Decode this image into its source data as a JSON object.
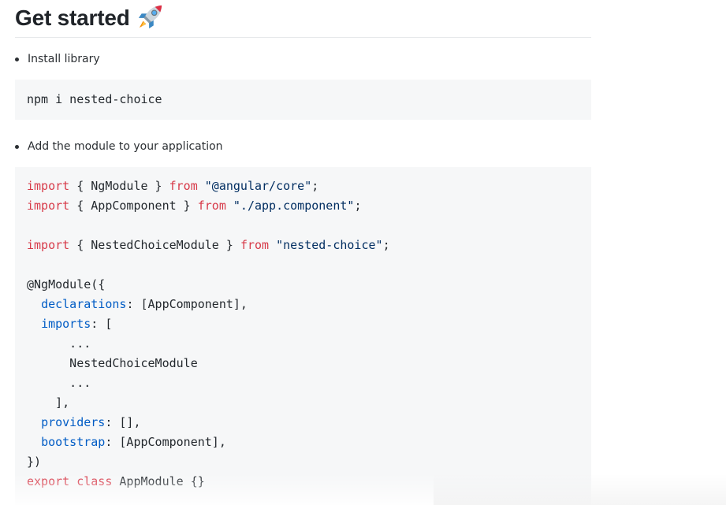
{
  "heading": {
    "title": "Get started",
    "emoji_icon": "rocket-icon"
  },
  "steps": [
    {
      "text": "Install library"
    },
    {
      "text": "Add the module to your application"
    }
  ],
  "code_blocks": [
    {
      "lines": [
        [
          {
            "t": "pl",
            "v": "npm i nested-choice"
          }
        ]
      ]
    },
    {
      "lines": [
        [
          {
            "t": "kw",
            "v": "import"
          },
          {
            "t": "pl",
            "v": " { NgModule } "
          },
          {
            "t": "kw",
            "v": "from"
          },
          {
            "t": "pl",
            "v": " "
          },
          {
            "t": "str",
            "v": "\"@angular/core\""
          },
          {
            "t": "pl",
            "v": ";"
          }
        ],
        [
          {
            "t": "kw",
            "v": "import"
          },
          {
            "t": "pl",
            "v": " { AppComponent } "
          },
          {
            "t": "kw",
            "v": "from"
          },
          {
            "t": "pl",
            "v": " "
          },
          {
            "t": "str",
            "v": "\"./app.component\""
          },
          {
            "t": "pl",
            "v": ";"
          }
        ],
        [],
        [
          {
            "t": "kw",
            "v": "import"
          },
          {
            "t": "pl",
            "v": " { NestedChoiceModule } "
          },
          {
            "t": "kw",
            "v": "from"
          },
          {
            "t": "pl",
            "v": " "
          },
          {
            "t": "str",
            "v": "\"nested-choice\""
          },
          {
            "t": "pl",
            "v": ";"
          }
        ],
        [],
        [
          {
            "t": "pl",
            "v": "@NgModule({"
          }
        ],
        [
          {
            "t": "pl",
            "v": "  "
          },
          {
            "t": "prop",
            "v": "declarations"
          },
          {
            "t": "pl",
            "v": ": [AppComponent],"
          }
        ],
        [
          {
            "t": "pl",
            "v": "  "
          },
          {
            "t": "prop",
            "v": "imports"
          },
          {
            "t": "pl",
            "v": ": ["
          }
        ],
        [
          {
            "t": "pl",
            "v": "      ..."
          }
        ],
        [
          {
            "t": "pl",
            "v": "      NestedChoiceModule"
          }
        ],
        [
          {
            "t": "pl",
            "v": "      ..."
          }
        ],
        [
          {
            "t": "pl",
            "v": "    ],"
          }
        ],
        [
          {
            "t": "pl",
            "v": "  "
          },
          {
            "t": "prop",
            "v": "providers"
          },
          {
            "t": "pl",
            "v": ": [],"
          }
        ],
        [
          {
            "t": "pl",
            "v": "  "
          },
          {
            "t": "prop",
            "v": "bootstrap"
          },
          {
            "t": "pl",
            "v": ": [AppComponent],"
          }
        ],
        [
          {
            "t": "pl",
            "v": "})"
          }
        ],
        [
          {
            "t": "kw",
            "v": "export"
          },
          {
            "t": "pl",
            "v": " "
          },
          {
            "t": "kw",
            "v": "class"
          },
          {
            "t": "pl",
            "v": " AppModule {}"
          }
        ]
      ]
    }
  ],
  "colors": {
    "keyword": "#d73a49",
    "string": "#032f62",
    "property": "#005cc5",
    "plain": "#24292e",
    "code_background": "#f6f7f8"
  }
}
